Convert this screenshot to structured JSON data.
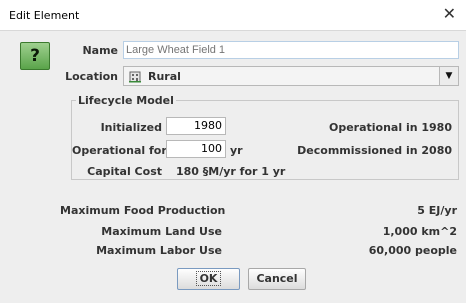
{
  "window": {
    "title": "Edit Element",
    "close_icon": "close-icon"
  },
  "help_icon": {
    "symbol": "?",
    "color": "#5aa44a"
  },
  "name": {
    "label": "Name",
    "placeholder": "Large Wheat Field 1"
  },
  "location": {
    "label": "Location",
    "value": "Rural",
    "icon": "rural-building-icon"
  },
  "lifecycle": {
    "title": "Lifecycle Model",
    "initialized_label": "Initialized",
    "initialized_value": "1980",
    "operational_in": "Operational in 1980",
    "operational_for_label": "Operational for",
    "operational_for_value": "100",
    "operational_for_unit": "yr",
    "decommissioned_in": "Decommissioned in 2080",
    "capital_cost_label": "Capital Cost",
    "capital_cost_value": "180 §M/yr for 1 yr"
  },
  "maximums": [
    {
      "label": "Maximum Food Production",
      "value": "5 EJ/yr"
    },
    {
      "label": "Maximum Land Use",
      "value": "1,000 km^2"
    },
    {
      "label": "Maximum Labor Use",
      "value": "60,000 people"
    }
  ],
  "buttons": {
    "ok": "OK",
    "cancel": "Cancel"
  }
}
